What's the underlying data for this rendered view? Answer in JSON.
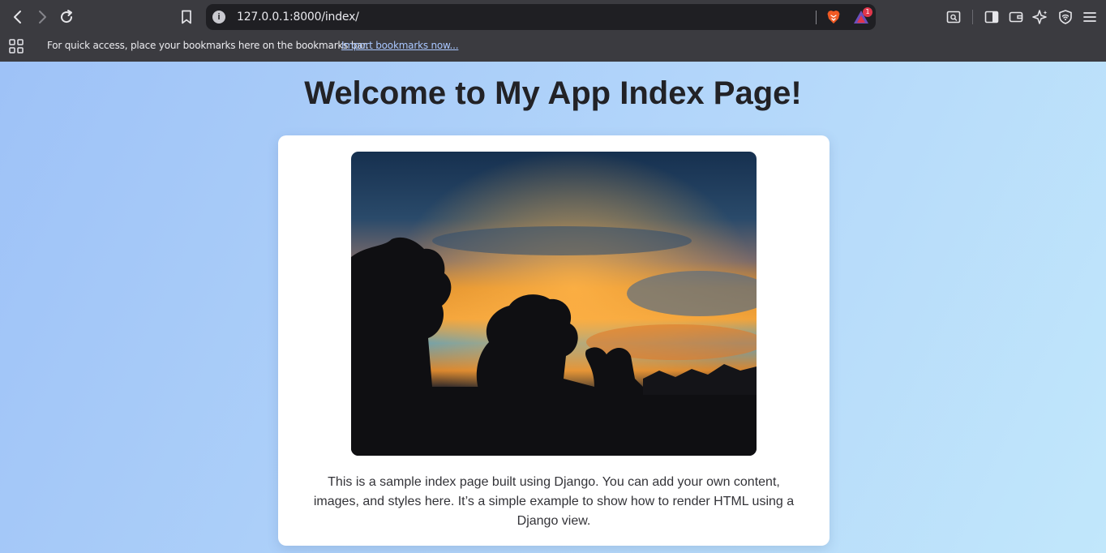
{
  "browser": {
    "url": "127.0.0.1:8000/index/",
    "rewards_badge_count": "1",
    "icons": {
      "back": "back-arrow-icon",
      "forward": "forward-arrow-icon",
      "reload": "reload-icon",
      "bookmark": "bookmark-icon",
      "site_info": "info-icon",
      "brave_shields": "brave-lion-icon",
      "brave_rewards": "brave-rewards-icon",
      "search_page": "search-page-icon",
      "sidebar": "sidebar-icon",
      "wallet": "wallet-icon",
      "leo_ai": "leo-ai-icon",
      "vpn": "vpn-shield-icon",
      "menu": "hamburger-menu-icon",
      "apps": "apps-grid-icon"
    },
    "colors": {
      "chrome": "#3b3b40",
      "urlbar": "#1f1f23",
      "link": "#a9c7ff"
    }
  },
  "bookmarks_bar": {
    "message": "For quick access, place your bookmarks here on the bookmarks bar.",
    "import_link": "Import bookmarks now..."
  },
  "page": {
    "heading": "Welcome to My App Index Page!",
    "description": "This is a sample index page built using Django. You can add your own content, images, and styles here. It’s a simple example to show how to render HTML using a Django view.",
    "image_alt": "sunset-silhouette-photo",
    "colors": {
      "background_start": "#9ec2f7",
      "background_end": "#c1e7fb",
      "card": "#ffffff",
      "heading": "#222226"
    }
  }
}
